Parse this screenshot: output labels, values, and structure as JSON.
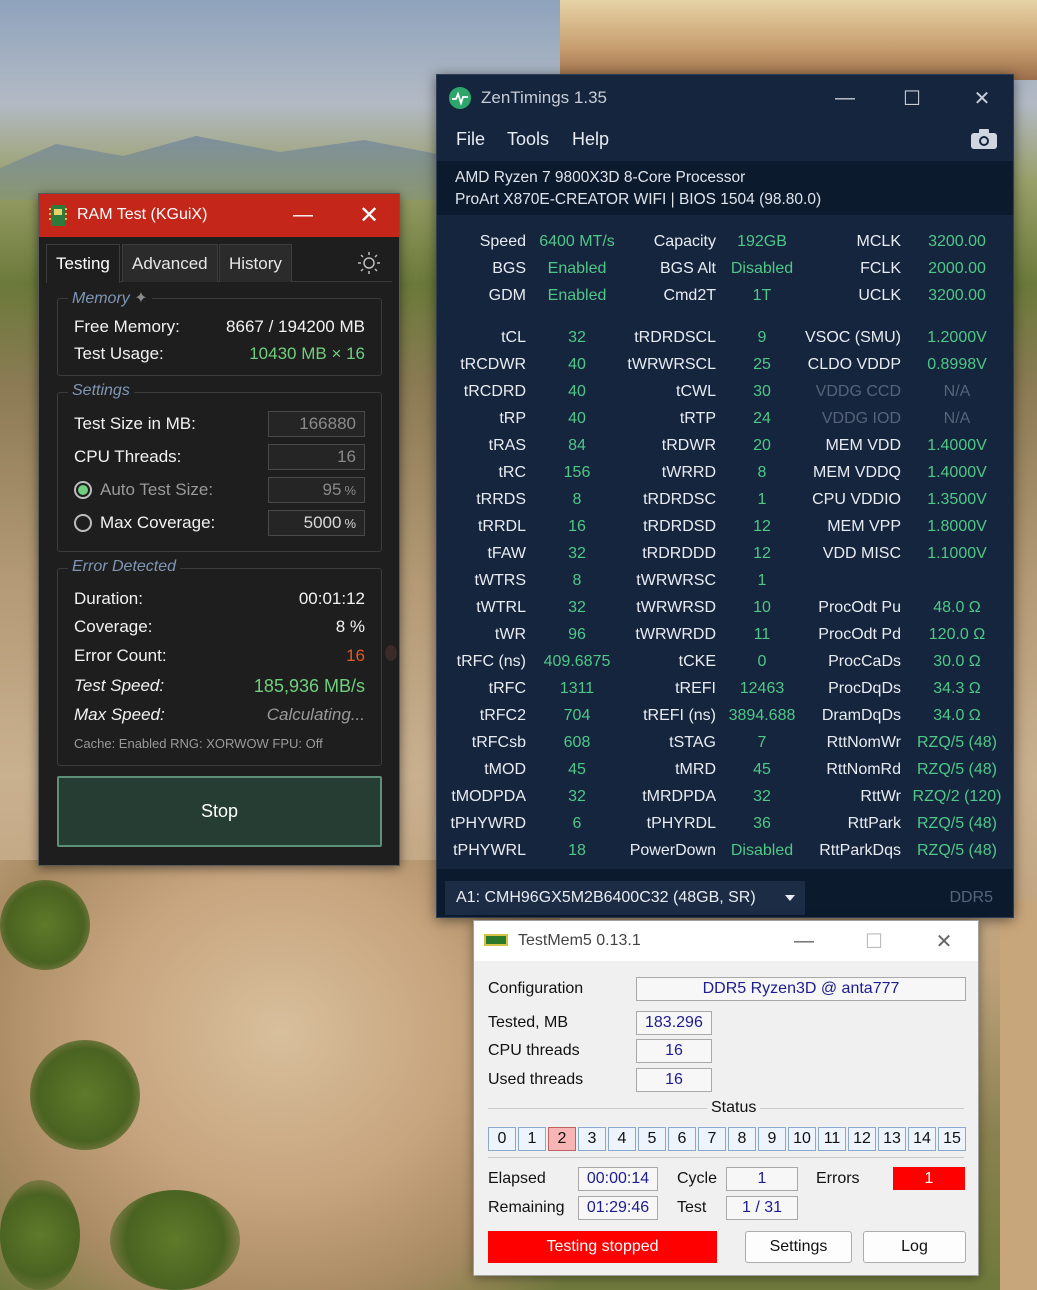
{
  "ramtest": {
    "title": "RAM Test (KGuiX)",
    "tabs": [
      "Testing",
      "Advanced",
      "History"
    ],
    "memory": {
      "label": "Memory",
      "free_label": "Free Memory:",
      "free_value": "8667 / 194200 MB",
      "usage_label": "Test Usage:",
      "usage_value": "10430 MB × 16"
    },
    "settings": {
      "label": "Settings",
      "size_label": "Test Size in MB:",
      "size_value": "166880",
      "threads_label": "CPU Threads:",
      "threads_value": "16",
      "auto_label": "Auto Test Size:",
      "auto_value": "95",
      "max_label": "Max Coverage:",
      "max_value": "5000",
      "percent": "%"
    },
    "error": {
      "label": "Error Detected",
      "duration_label": "Duration:",
      "duration_value": "00:01:12",
      "coverage_label": "Coverage:",
      "coverage_value": "8 %",
      "count_label": "Error Count:",
      "count_value": "16",
      "speed_label": "Test Speed:",
      "speed_value": "185,936 MB/s",
      "max_label": "Max Speed:",
      "max_value": "Calculating...",
      "footer": "Cache: Enabled  RNG: XORWOW  FPU: Off"
    },
    "stop_label": "Stop"
  },
  "zentimings": {
    "title": "ZenTimings 1.35",
    "menu": [
      "File",
      "Tools",
      "Help"
    ],
    "cpu": "AMD Ryzen 7 9800X3D 8-Core Processor",
    "board": "ProArt X870E-CREATOR WIFI | BIOS 1504 (98.80.0)",
    "top": [
      [
        "Speed",
        "6400 MT/s",
        "Capacity",
        "192GB",
        "MCLK",
        "3200.00"
      ],
      [
        "BGS",
        "Enabled",
        "BGS Alt",
        "Disabled",
        "FCLK",
        "2000.00"
      ],
      [
        "GDM",
        "Enabled",
        "Cmd2T",
        "1T",
        "UCLK",
        "3200.00"
      ]
    ],
    "rows": [
      [
        "tCL",
        "32",
        "tRDRDSCL",
        "9",
        "VSOC (SMU)",
        "1.2000V"
      ],
      [
        "tRCDWR",
        "40",
        "tWRWRSCL",
        "25",
        "CLDO VDDP",
        "0.8998V"
      ],
      [
        "tRCDRD",
        "40",
        "tCWL",
        "30",
        "VDDG CCD",
        "N/A"
      ],
      [
        "tRP",
        "40",
        "tRTP",
        "24",
        "VDDG IOD",
        "N/A"
      ],
      [
        "tRAS",
        "84",
        "tRDWR",
        "20",
        "MEM VDD",
        "1.4000V"
      ],
      [
        "tRC",
        "156",
        "tWRRD",
        "8",
        "MEM VDDQ",
        "1.4000V"
      ],
      [
        "tRRDS",
        "8",
        "tRDRDSC",
        "1",
        "CPU VDDIO",
        "1.3500V"
      ],
      [
        "tRRDL",
        "16",
        "tRDRDSD",
        "12",
        "MEM VPP",
        "1.8000V"
      ],
      [
        "tFAW",
        "32",
        "tRDRDDD",
        "12",
        "VDD MISC",
        "1.1000V"
      ],
      [
        "tWTRS",
        "8",
        "tWRWRSC",
        "1",
        "",
        ""
      ],
      [
        "tWTRL",
        "32",
        "tWRWRSD",
        "10",
        "ProcOdt Pu",
        "48.0 Ω"
      ],
      [
        "tWR",
        "96",
        "tWRWRDD",
        "11",
        "ProcOdt Pd",
        "120.0 Ω"
      ],
      [
        "tRFC (ns)",
        "409.6875",
        "tCKE",
        "0",
        "ProcCaDs",
        "30.0 Ω"
      ],
      [
        "tRFC",
        "1311",
        "tREFI",
        "12463",
        "ProcDqDs",
        "34.3 Ω"
      ],
      [
        "tRFC2",
        "704",
        "tREFI (ns)",
        "3894.688",
        "DramDqDs",
        "34.0 Ω"
      ],
      [
        "tRFCsb",
        "608",
        "tSTAG",
        "7",
        "RttNomWr",
        "RZQ/5 (48)"
      ],
      [
        "tMOD",
        "45",
        "tMRD",
        "45",
        "RttNomRd",
        "RZQ/5 (48)"
      ],
      [
        "tMODPDA",
        "32",
        "tMRDPDA",
        "32",
        "RttWr",
        "RZQ/2 (120)"
      ],
      [
        "tPHYWRD",
        "6",
        "tPHYRDL",
        "36",
        "RttPark",
        "RZQ/5 (48)"
      ],
      [
        "tPHYWRL",
        "18",
        "PowerDown",
        "Disabled",
        "RttParkDqs",
        "RZQ/5 (48)"
      ]
    ],
    "dim_rows": [
      2,
      3
    ],
    "module": "A1: CMH96GX5M2B6400C32 (48GB, SR)",
    "ddr": "DDR5"
  },
  "testmem5": {
    "title": "TestMem5  0.13.1",
    "config_label": "Configuration",
    "config_value": "DDR5 Ryzen3D @ anta777",
    "tested_label": "Tested, MB",
    "tested_value": "183.296",
    "cpu_label": "CPU threads",
    "cpu_value": "16",
    "used_label": "Used threads",
    "used_value": "16",
    "status_label": "Status",
    "threads": [
      "0",
      "1",
      "2",
      "3",
      "4",
      "5",
      "6",
      "7",
      "8",
      "9",
      "10",
      "11",
      "12",
      "13",
      "14",
      "15"
    ],
    "error_thread": 2,
    "elapsed_label": "Elapsed",
    "elapsed_value": "00:00:14",
    "remaining_label": "Remaining",
    "remaining_value": "01:29:46",
    "cycle_label": "Cycle",
    "cycle_value": "1",
    "test_label": "Test",
    "test_value": "1 / 31",
    "errors_label": "Errors",
    "errors_value": "1",
    "state": "Testing stopped",
    "settings_label": "Settings",
    "log_label": "Log"
  },
  "colors": {
    "ramtest_titlebar": "#c4261a",
    "zen_bg": "#15253d",
    "zen_value": "#4fc787",
    "error_red": "#ff0000"
  }
}
